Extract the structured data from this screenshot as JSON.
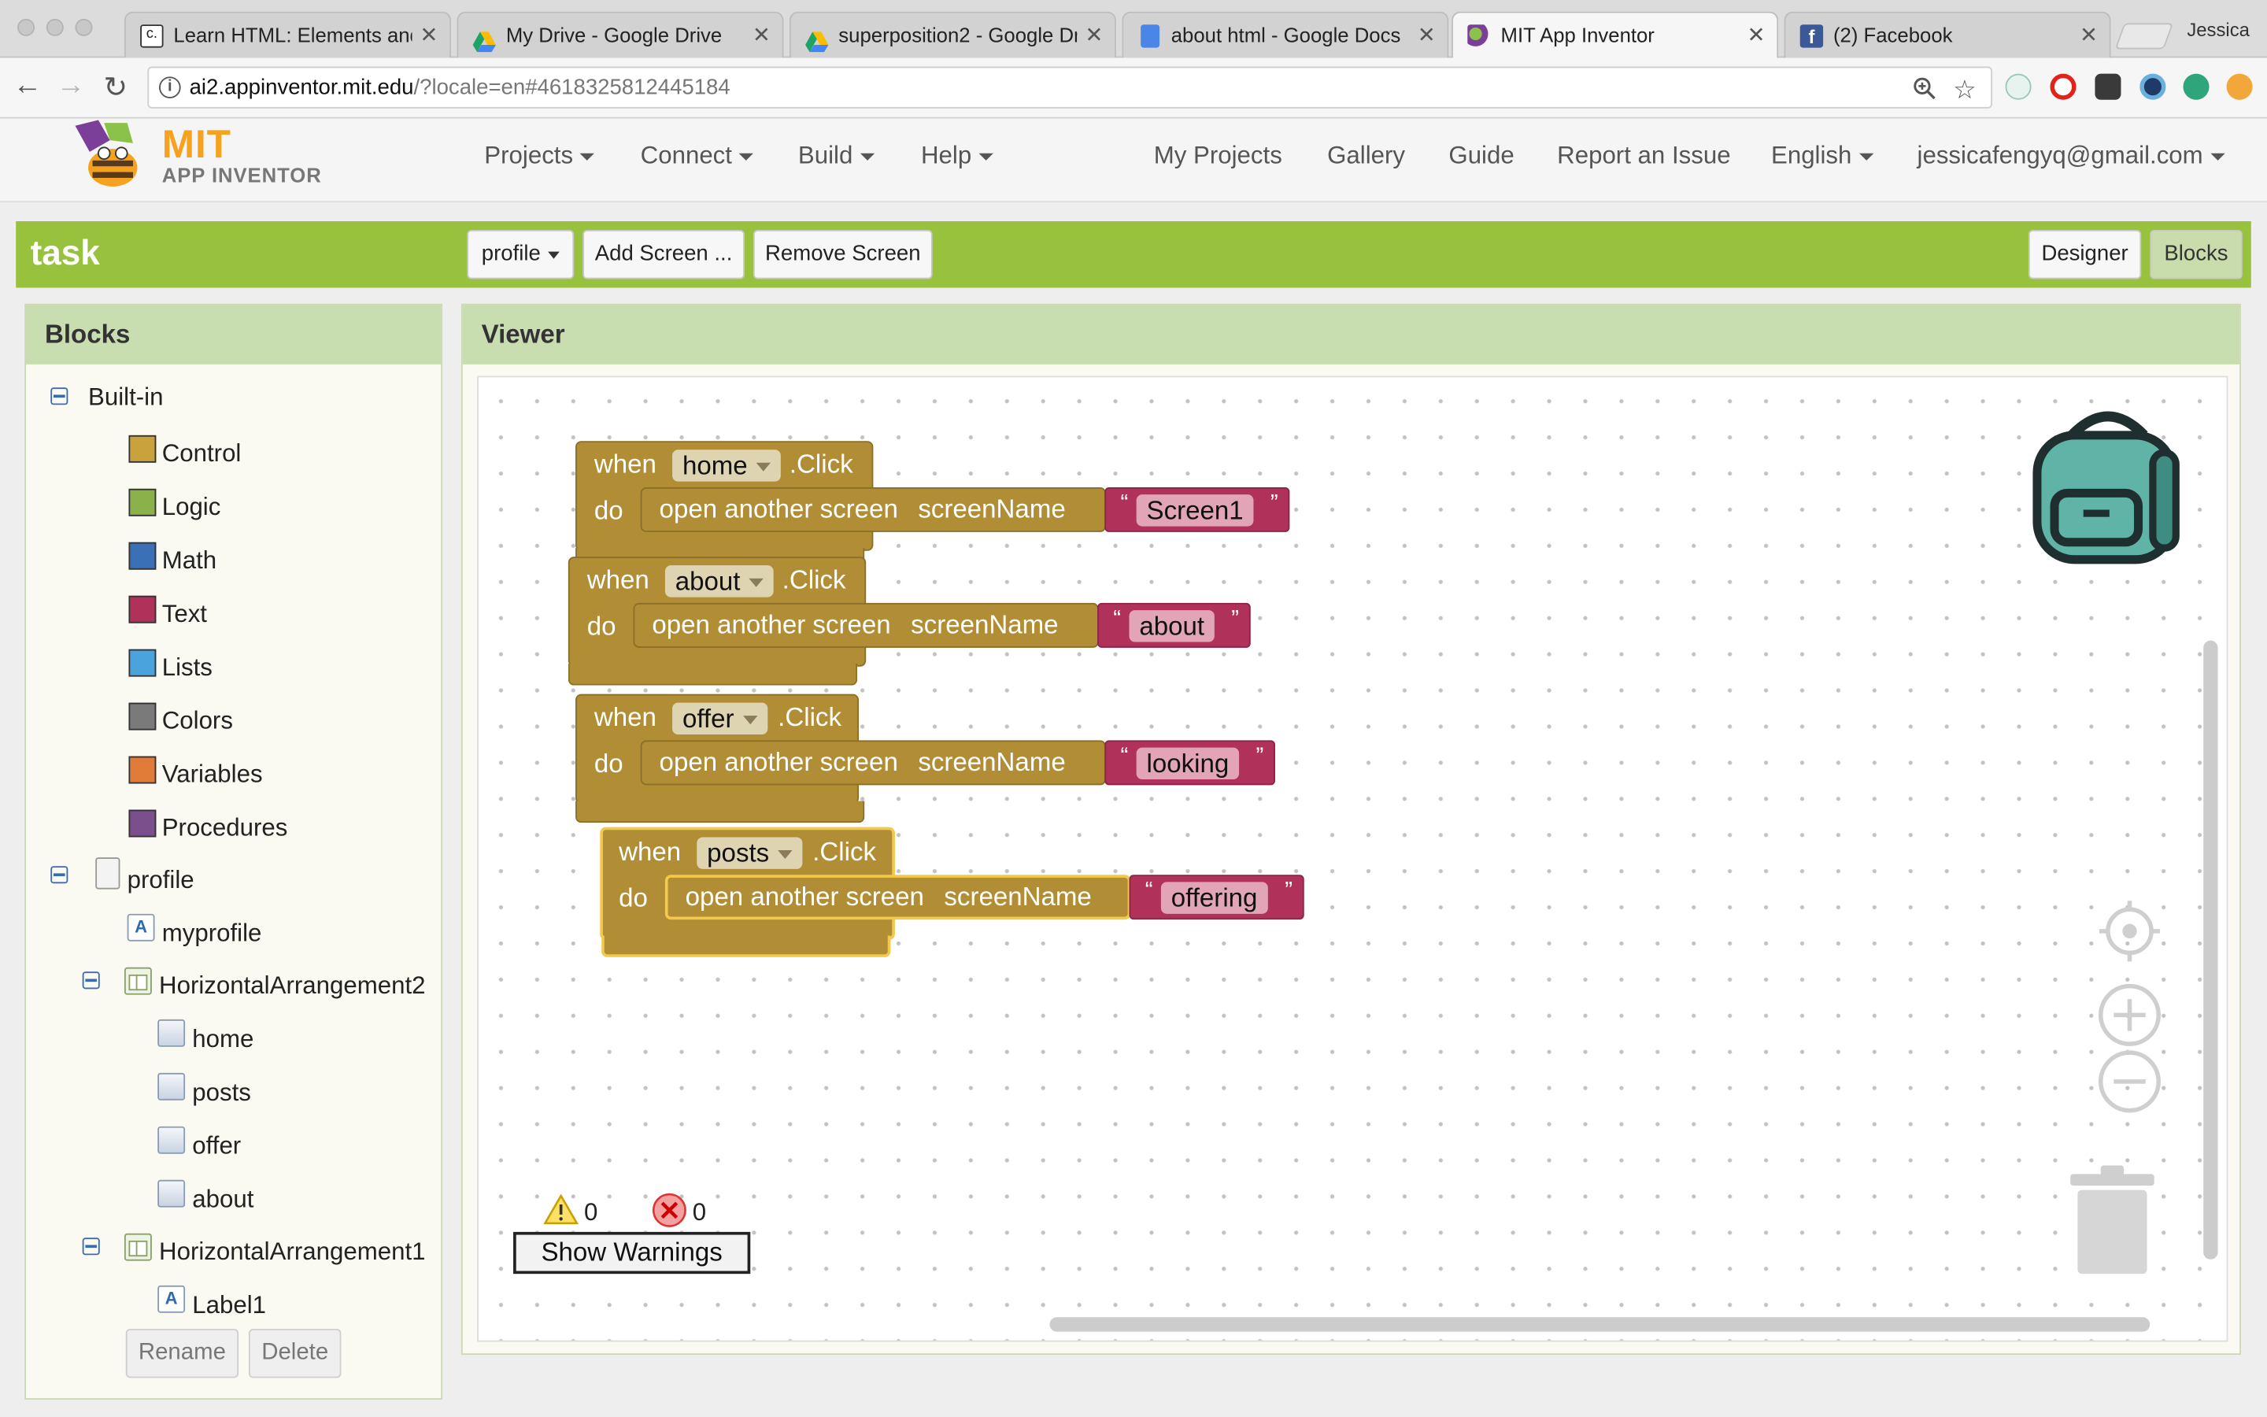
{
  "browser": {
    "tabs": [
      {
        "title": "Learn HTML: Elements and",
        "active": false
      },
      {
        "title": "My Drive - Google Drive",
        "active": false
      },
      {
        "title": "superposition2 - Google Dr",
        "active": false
      },
      {
        "title": "about html - Google Docs",
        "active": false
      },
      {
        "title": "MIT App Inventor",
        "active": true
      },
      {
        "title": "(2) Facebook",
        "active": false
      }
    ],
    "profile_name": "Jessica",
    "url_host": "ai2.appinventor.mit.edu",
    "url_rest": "/?locale=en#4618325812445184"
  },
  "header": {
    "logo_mit": "MIT",
    "logo_sub": "APP INVENTOR",
    "menus": {
      "projects": "Projects",
      "connect": "Connect",
      "build": "Build",
      "help": "Help"
    },
    "links": {
      "my_projects": "My Projects",
      "gallery": "Gallery",
      "guide": "Guide",
      "report": "Report an Issue",
      "language": "English",
      "account": "jessicafengyq@gmail.com"
    }
  },
  "projectbar": {
    "name": "task",
    "screen": "profile",
    "add_screen": "Add Screen ...",
    "remove_screen": "Remove Screen",
    "designer": "Designer",
    "blocks": "Blocks"
  },
  "blocks_panel": {
    "title": "Blocks",
    "builtin_label": "Built-in",
    "builtin": [
      {
        "label": "Control",
        "color": "#c9a23d"
      },
      {
        "label": "Logic",
        "color": "#8bb24a"
      },
      {
        "label": "Math",
        "color": "#3b6fb6"
      },
      {
        "label": "Text",
        "color": "#b0325a"
      },
      {
        "label": "Lists",
        "color": "#4aa3dd"
      },
      {
        "label": "Colors",
        "color": "#7a7a7a"
      },
      {
        "label": "Variables",
        "color": "#e07b39"
      },
      {
        "label": "Procedures",
        "color": "#7b4f8c"
      }
    ],
    "screen_label": "profile",
    "components": {
      "myprofile": "myprofile",
      "harr2": "HorizontalArrangement2",
      "home": "home",
      "posts": "posts",
      "offer": "offer",
      "about": "about",
      "harr1": "HorizontalArrangement1",
      "label1": "Label1"
    },
    "rename": "Rename",
    "delete": "Delete"
  },
  "viewer": {
    "title": "Viewer",
    "when": "when",
    "do": "do",
    "click": ".Click",
    "open_screen": "open another screen",
    "screen_name": "screenName",
    "open_quote": "“",
    "close_quote": "”",
    "handlers": [
      {
        "component": "home",
        "target": "Screen1"
      },
      {
        "component": "about",
        "target": "about"
      },
      {
        "component": "offer",
        "target": "looking"
      },
      {
        "component": "posts",
        "target": "offering"
      }
    ],
    "warnings_count": "0",
    "errors_count": "0",
    "show_warnings": "Show Warnings"
  }
}
